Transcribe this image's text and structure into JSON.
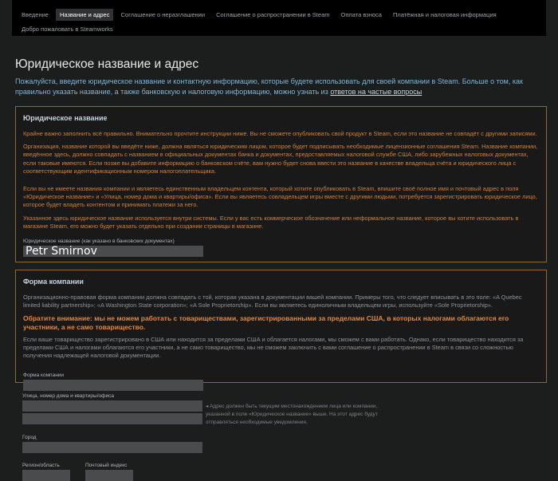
{
  "nav": {
    "tabs": [
      "Введение",
      "Название и адрес",
      "Соглашение о неразглашении",
      "Соглашение о распространении в Steam",
      "Оплата взноса",
      "Платёжная и налоговая информация",
      "Добро пожаловать в Steamworks"
    ]
  },
  "title": "Юридическое название и адрес",
  "intro": {
    "text": "Пожалуйста, введите юридическое название и контактную информацию, которые будете использовать для своей компании в Steam. Больше о том, как правильно указать название, а также банковскую и налоговую информацию, можно узнать из ",
    "link": "ответов на частые вопросы"
  },
  "legal": {
    "heading": "Юридическое название",
    "p": [
      "Крайне важно заполнить всё правильно. Внимательно прочтите инструкции ниже. Вы не сможете опубликовать свой продукт в Steam, если это название не совпадёт с другими записями.",
      "Организация, название которой вы введёте ниже, должна являться юридическим лицом, которое будет подписывать необходимые лицензионные соглашения Steam. Название компании, введённое здесь, должно совпадать с названием в официальных документах банка и документах, предоставляемых налоговой службе США, либо зарубежных налоговых документах, если таковые имеются. Если позже вы добавите информацию о банковском счёте, вам нужно будет снова ввести это название в качестве владельца счёта и юридического лица с соответствующим идентификационным номером налогоплательщика.",
      "Если вы не имеете названия компании и являетесь единственным владельцем контента, который хотите опубликовать в Steam, впишите своё полное имя и почтовый адрес в поля «Юридическое название» и «Улица, номер дома и квартиры/офиса». Если вы являетесь совладельцем игры вместе с другими людьми, потребуется зарегистрировать юридическое лицо, которое будет владеть контентом и принимать платежи за него.",
      "Указанное здесь юридическое название используется внутри системы. Если у вас есть коммерческое обозначение или неформальное название, которое вы хотите использовать в магазине Steam, его можно будет указать отдельно при создании страницы в магазине."
    ],
    "field_label": "Юридическое название (как указано в банковских документах)",
    "field_value": "Petr Smirnov"
  },
  "form": {
    "heading": "Форма компании",
    "p1": "Организационно-правовая форма компании должна совпадать с той, которая указана в документации вашей компании. Примеры того, что следует вписывать в это поле: «A Quebec limited liability partnership»; «A Washington State corporation»; «A Sole Proprietorship». Если вы являетесь единоличным владельцем игры, используйте «Sole Proprietorship».",
    "warning": "Обратите внимание: мы не можем работать с товариществами, зарегистрированными за пределами США, в которых налогами облагаются его участники, а не само товарищество.",
    "p2": "Если ваше товарищество зарегистрировано в США или находится за пределами США и облагается налогами, мы сможем с вами работать. Однако, если товарищество находится за пределами США и налогами облагаются его участники, а не само товарищество, мы не сможем заключить с вами соглашение о распространении в Steam в связи со сложностью получения надлежащей налоговой документации.",
    "field_label": "Форма компании"
  },
  "address": {
    "street_label": "Улица, номер дома и квартиры/офиса",
    "note": "Адрес должен быть текущим местонахождением лица или компании, указанной в поле «Юридическое название» выше. На этот адрес будут отправляться необходимые уведомления.",
    "city_label": "Город",
    "region_label": "Регион/область",
    "zip_label": "Почтовый индекс"
  }
}
